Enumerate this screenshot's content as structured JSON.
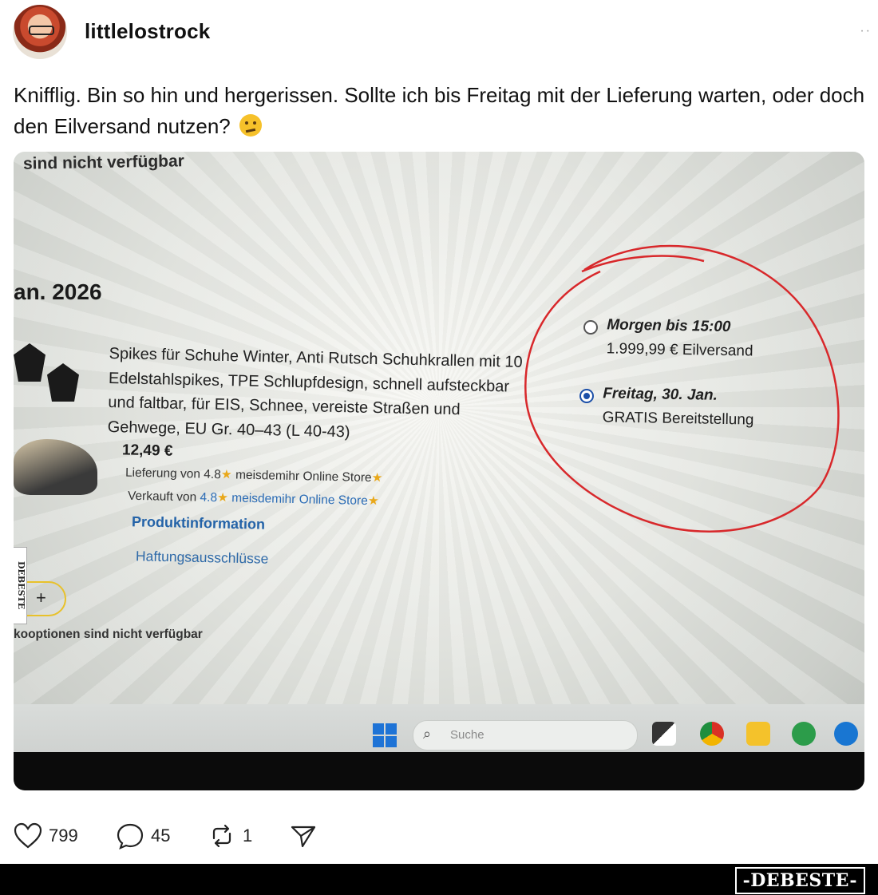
{
  "post": {
    "username": "littlelostrock",
    "more_label": "··",
    "text": "Knifflig. Bin so hin und hergerissen. Sollte ich bis Freitag mit der Lieferung warten, oder doch den Eilversand nutzen?"
  },
  "photo": {
    "top_cut_text": "sind nicht verfügbar",
    "date_heading": "an. 2026",
    "product_title": "Spikes für Schuhe Winter, Anti Rutsch Schuhkrallen mit 10 Edelstahlspikes, TPE Schlupfdesign, schnell aufsteckbar und faltbar, für EIS, Schnee, vereiste Straßen und Gehwege, EU Gr. 40–43 (L 40-43)",
    "price": "12,49 €",
    "delivery_prefix": "Lieferung von",
    "delivery_rating": "4.8",
    "delivery_store": "meisdemihr Online Store",
    "sold_prefix": "Verkauft von",
    "sold_rating": "4.8",
    "sold_store": "meisdemihr Online Store",
    "product_info_link": "Produktinformation",
    "disclaimer_link": "Haftungsausschlüsse",
    "qty_plus": "+",
    "bottom_note": "kooptionen sind nicht verfügbar",
    "option1_title": "Morgen bis 15:00",
    "option1_sub": "1.999,99 € Eilversand",
    "option2_title": "Freitag, 30. Jan.",
    "option2_sub": "GRATIS Bereitstellung",
    "taskbar_search": "Suche"
  },
  "actions": {
    "likes": "799",
    "comments": "45",
    "reposts": "1"
  },
  "watermark": {
    "footer_brand": "-DEBESTE-",
    "side_brand": "DEBESTE"
  },
  "colors": {
    "circle": "#d8282b",
    "radio_selected": "#1b4fa8",
    "link": "#2463a8"
  }
}
